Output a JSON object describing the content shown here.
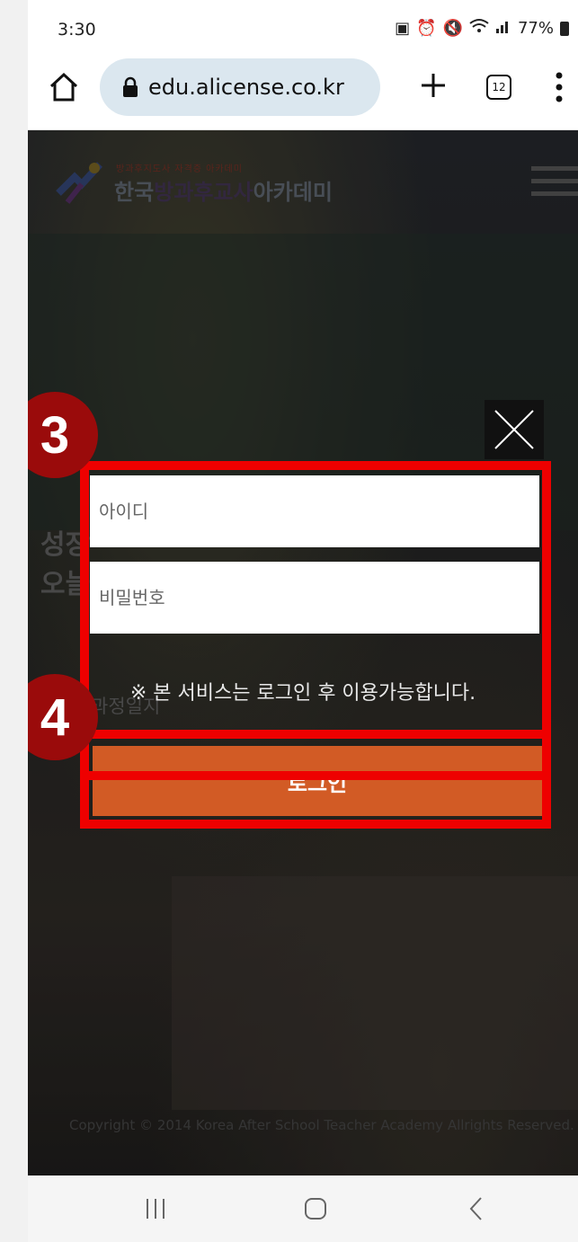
{
  "status_bar": {
    "time": "3:30",
    "icons": [
      "battery-saver-icon",
      "alarm-icon",
      "mute-icon",
      "wifi-icon",
      "signal-icon"
    ],
    "battery": "77%"
  },
  "browser": {
    "url": "edu.alicense.co.kr",
    "tab_count": "12",
    "icons": [
      "home-icon",
      "lock-icon",
      "plus-icon",
      "tabs-icon",
      "more-vert-icon"
    ]
  },
  "site": {
    "logo_sub": "방과후지도사 자격증 아카데미",
    "logo_left": "한국",
    "logo_mid": "방과후교사",
    "logo_right": "아카데미",
    "headline_line1": "성장",
    "headline_line2": "오늘",
    "link_text": "과정일지",
    "copyright": "Copyright © 2014 Korea After School Teacher Academy Allrights Reserved."
  },
  "login_modal": {
    "id_placeholder": "아이디",
    "pw_placeholder": "비밀번호",
    "notice": "※ 본 서비스는 로그인 후 이용가능합니다.",
    "login_label": "로그인",
    "close_icon": "close-icon"
  },
  "annotations": {
    "step_3": "3",
    "step_4": "4",
    "highlight_color": "#ee0000",
    "badge_color": "#9a0b0b"
  },
  "colors": {
    "login_button": "#d25b25",
    "url_pill": "#dbe7ef"
  }
}
